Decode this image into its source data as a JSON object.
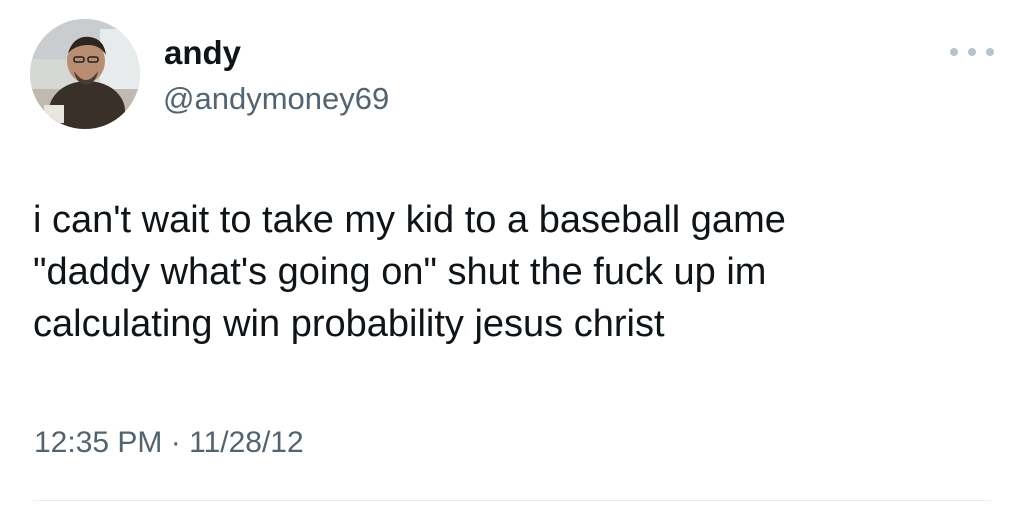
{
  "author": {
    "display_name": "andy",
    "handle": "@andymoney69",
    "avatar": "profile-photo"
  },
  "more_menu": {
    "icon": "more-options-icon"
  },
  "tweet": {
    "lines": [
      "i can't wait to take my kid to a baseball game",
      "\"daddy what's going on\" shut the fuck up im",
      "calculating win probability jesus christ"
    ],
    "time": "12:35 PM",
    "separator": "·",
    "date": "11/28/12"
  },
  "colors": {
    "text": "#0f1419",
    "secondary_text": "#536471",
    "divider": "#e6ecf0"
  }
}
